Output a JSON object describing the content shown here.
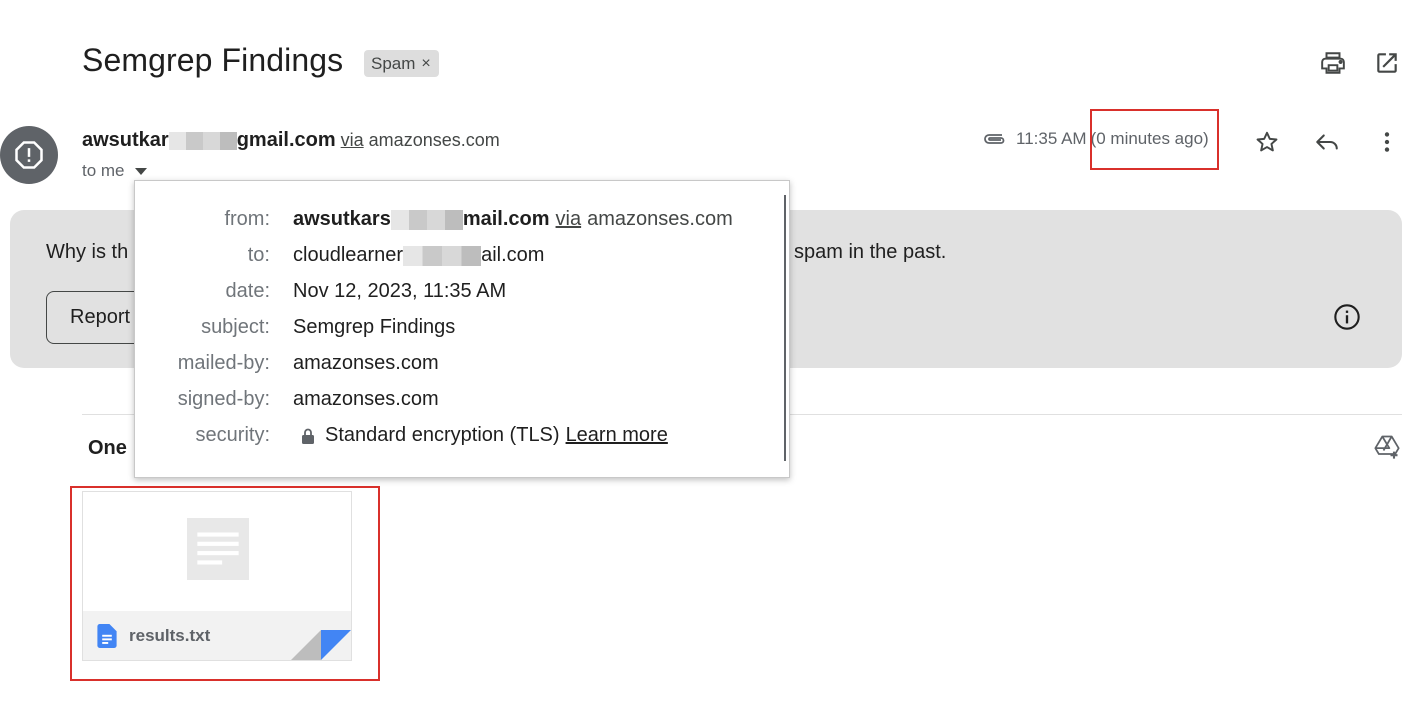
{
  "email": {
    "subject": "Semgrep Findings",
    "label_chip": "Spam",
    "label_chip_close": "×",
    "sender_prefix": "awsutkar",
    "sender_suffix": "gmail.com",
    "via_word": "via",
    "via_domain": "amazonses.com",
    "to_line": "to me",
    "time": "11:35 AM",
    "relative_time": "(0 minutes ago)"
  },
  "banner": {
    "text_left": "Why is th",
    "text_right": "spam in the past.",
    "report_button": "Report"
  },
  "attachments": {
    "title": "One",
    "files": [
      {
        "name": "results.txt",
        "icon": "google-docs-icon"
      }
    ]
  },
  "details_popup": {
    "rows": [
      {
        "label": "from:",
        "value_bold_prefix": "awsutkars",
        "value_bold_suffix": "mail.com",
        "via_word": "via",
        "via_domain": "amazonses.com"
      },
      {
        "label": "to:",
        "value_prefix": "cloudlearner",
        "value_suffix": "ail.com"
      },
      {
        "label": "date:",
        "value": "Nov 12, 2023, 11:35 AM"
      },
      {
        "label": "subject:",
        "value": "Semgrep Findings"
      },
      {
        "label": "mailed-by:",
        "value": "amazonses.com"
      },
      {
        "label": "signed-by:",
        "value": "amazonses.com"
      },
      {
        "label": "security:",
        "value": "Standard encryption (TLS)",
        "link": "Learn more",
        "icon": "lock-icon"
      }
    ]
  },
  "colors": {
    "highlight_red": "#d9302b",
    "banner_gray": "#e1e1e1",
    "docs_blue": "#4285f4"
  }
}
